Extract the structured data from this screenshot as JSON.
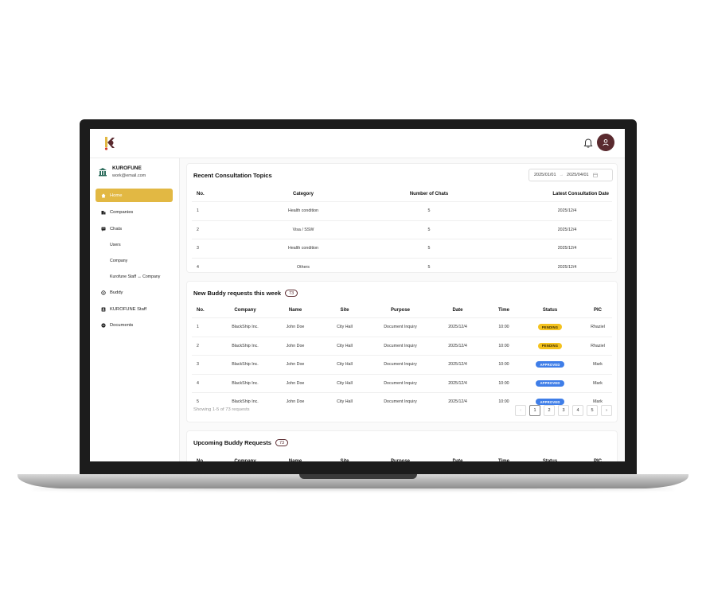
{
  "app": {
    "org_name": "KUROFUNE",
    "org_email": "work@email.com",
    "brand_color": "#e2b843",
    "accent_color": "#5a2a2f"
  },
  "header": {
    "icons": [
      "logo-icon",
      "bell-icon",
      "user-icon"
    ]
  },
  "sidebar": {
    "items": [
      {
        "label": "Home",
        "icon": "home-icon"
      },
      {
        "label": "Companies",
        "icon": "building-icon"
      },
      {
        "label": "Chats",
        "icon": "chat-icon"
      },
      {
        "label": "Users"
      },
      {
        "label": "Company"
      },
      {
        "label": "Kurofune Staff ↔ Company"
      },
      {
        "label": "Buddy",
        "icon": "buddy-icon"
      },
      {
        "label": "KUROFUNE Staff",
        "icon": "staff-icon"
      },
      {
        "label": "Documents",
        "icon": "documents-icon"
      }
    ]
  },
  "consultation": {
    "title": "Recent Consultation Topics",
    "date_from": "2025/01/01",
    "date_sep": "→",
    "date_to": "2025/04/01",
    "headers": [
      "No.",
      "Category",
      "Number of Chats",
      "Latest Consultation Date"
    ],
    "rows": [
      [
        "1",
        "Health condition",
        "5",
        "2025/12/4"
      ],
      [
        "2",
        "Visa / SSW",
        "5",
        "2025/12/4"
      ],
      [
        "3",
        "Health condition",
        "5",
        "2025/12/4"
      ],
      [
        "4",
        "Others",
        "5",
        "2025/12/4"
      ]
    ]
  },
  "new_requests": {
    "title": "New Buddy requests this week",
    "count": "73",
    "headers": [
      "No.",
      "Company",
      "Name",
      "Site",
      "Purpose",
      "Date",
      "Time",
      "Status",
      "PIC"
    ],
    "rows": [
      [
        "1",
        "BlackShip Inc.",
        "John Doe",
        "City Hall",
        "Document Inquiry",
        "2025/12/4",
        "10:00",
        "PENDING",
        "Rhaziel"
      ],
      [
        "2",
        "BlackShip Inc.",
        "John Doe",
        "City Hall",
        "Document Inquiry",
        "2025/12/4",
        "10:00",
        "PENDING",
        "Rhaziel"
      ],
      [
        "3",
        "BlackShip Inc.",
        "John Doe",
        "City Hall",
        "Document Inquiry",
        "2025/12/4",
        "10:00",
        "APPROVED",
        "Mark"
      ],
      [
        "4",
        "BlackShip Inc.",
        "John Doe",
        "City Hall",
        "Document Inquiry",
        "2025/12/4",
        "10:00",
        "APPROVED",
        "Mark"
      ],
      [
        "5",
        "BlackShip Inc.",
        "John Doe",
        "City Hall",
        "Document Inquiry",
        "2025/12/4",
        "10:00",
        "APPROVED",
        "Mark"
      ]
    ],
    "showing_text": "Showing 1-5 of 73 requests",
    "pages": [
      "‹",
      "1",
      "2",
      "3",
      "4",
      "5",
      "›"
    ],
    "current_page": "1",
    "status_colors": {
      "PENDING": "#f4c21e",
      "APPROVED": "#3f7ee8"
    }
  },
  "upcoming": {
    "title": "Upcoming Buddy Requests",
    "count": "73",
    "headers": [
      "No.",
      "Company",
      "Name",
      "Site",
      "Purpose",
      "Date",
      "Time",
      "Status",
      "PIC"
    ]
  }
}
